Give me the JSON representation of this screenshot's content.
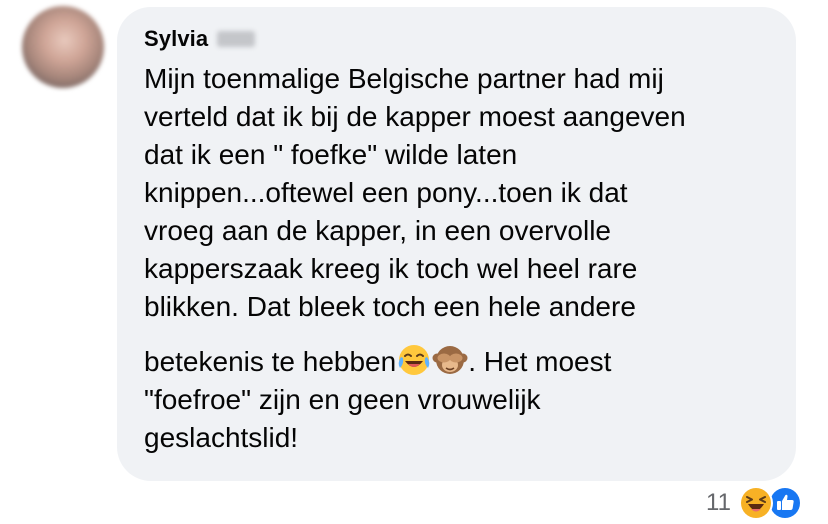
{
  "comment": {
    "author": "Sylvia",
    "lines": [
      "Mijn toenmalige Belgische partner had mij",
      "verteld dat ik bij de kapper moest aangeven",
      "dat ik een \" foefke\" wilde laten",
      "knippen...oftewel een pony...toen ik dat",
      "vroeg aan de kapper, in een overvolle",
      "kapperszaak kreeg ik toch wel heel rare",
      "blikken. Dat bleek toch een hele andere",
      "betekenis te hebben",
      ". Het moest",
      "\"foefroe\" zijn en geen vrouwelijk",
      "geslachtslid!"
    ],
    "inline_emojis": [
      "face-with-tears-of-joy",
      "see-no-evil-monkey"
    ]
  },
  "reactions": {
    "count": "11",
    "icons": [
      "haha",
      "like"
    ],
    "colors": {
      "like": "#1877f2",
      "haha": "#f7b125"
    }
  },
  "colors": {
    "bubble": "#f0f2f5",
    "text": "#050505",
    "meta": "#65676b"
  }
}
